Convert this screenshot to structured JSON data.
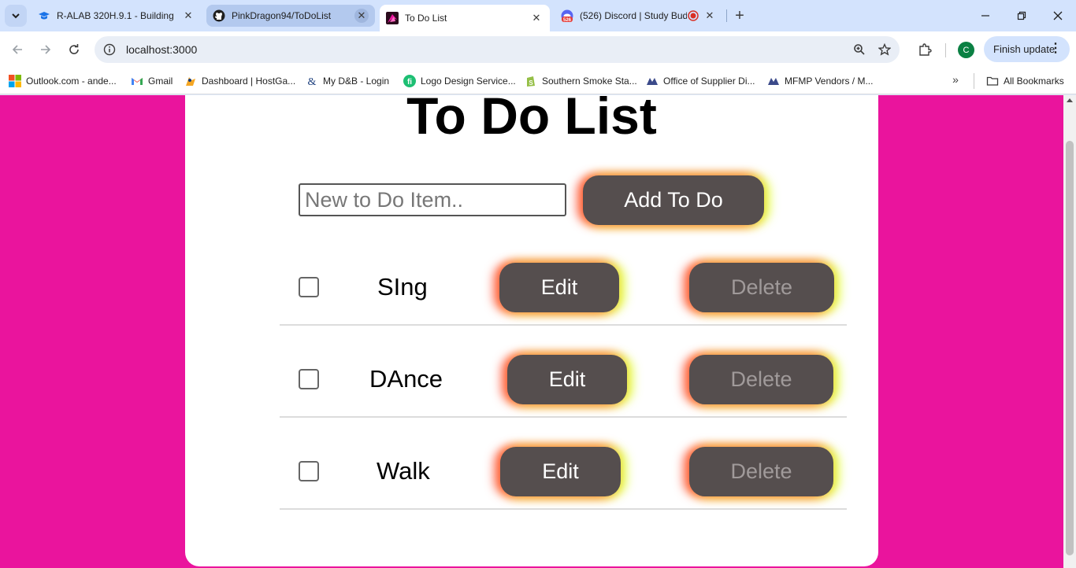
{
  "browser": {
    "tabs": [
      {
        "title": "R-ALAB 320H.9.1 - Building",
        "favicon": "graduation-cap-icon"
      },
      {
        "title": "PinkDragon94/ToDoList",
        "favicon": "github-icon"
      },
      {
        "title": "To Do List",
        "favicon": "pink-dragon-icon"
      },
      {
        "title": "(526) Discord | Study Bud",
        "favicon": "discord-icon",
        "badge": "526"
      }
    ],
    "new_tab": "+",
    "url": "localhost:3000",
    "finish_update": "Finish update",
    "profile_initial": "C",
    "bookmarks": [
      {
        "label": "Outlook.com - ande...",
        "icon": "windows-icon"
      },
      {
        "label": "Gmail",
        "icon": "gmail-icon"
      },
      {
        "label": "Dashboard | HostGa...",
        "icon": "hostgator-icon"
      },
      {
        "label": "My D&B - Login",
        "icon": "dnb-icon"
      },
      {
        "label": "Logo Design Service...",
        "icon": "fiverr-icon"
      },
      {
        "label": "Southern Smoke Sta...",
        "icon": "shopify-icon"
      },
      {
        "label": "Office of Supplier Di...",
        "icon": "osd-icon"
      },
      {
        "label": "MFMP Vendors / M...",
        "icon": "mfmp-icon"
      }
    ],
    "all_bookmarks": "All Bookmarks",
    "colors": {
      "tabstrip": "#d3e3fd",
      "page_bg": "#ea149d"
    }
  },
  "app": {
    "title": "To Do List",
    "input_placeholder": "New to Do Item..",
    "add_button": "Add To Do",
    "items": [
      {
        "text": "SIng",
        "checked": false,
        "edit": "Edit",
        "delete": "Delete"
      },
      {
        "text": "DAnce",
        "checked": false,
        "edit": "Edit",
        "delete": "Delete"
      },
      {
        "text": "Walk",
        "checked": false,
        "edit": "Edit",
        "delete": "Delete"
      }
    ],
    "colors": {
      "button": "#554e4e",
      "glow_left": "#ff4628",
      "glow_right": "#e1ff3c"
    }
  }
}
